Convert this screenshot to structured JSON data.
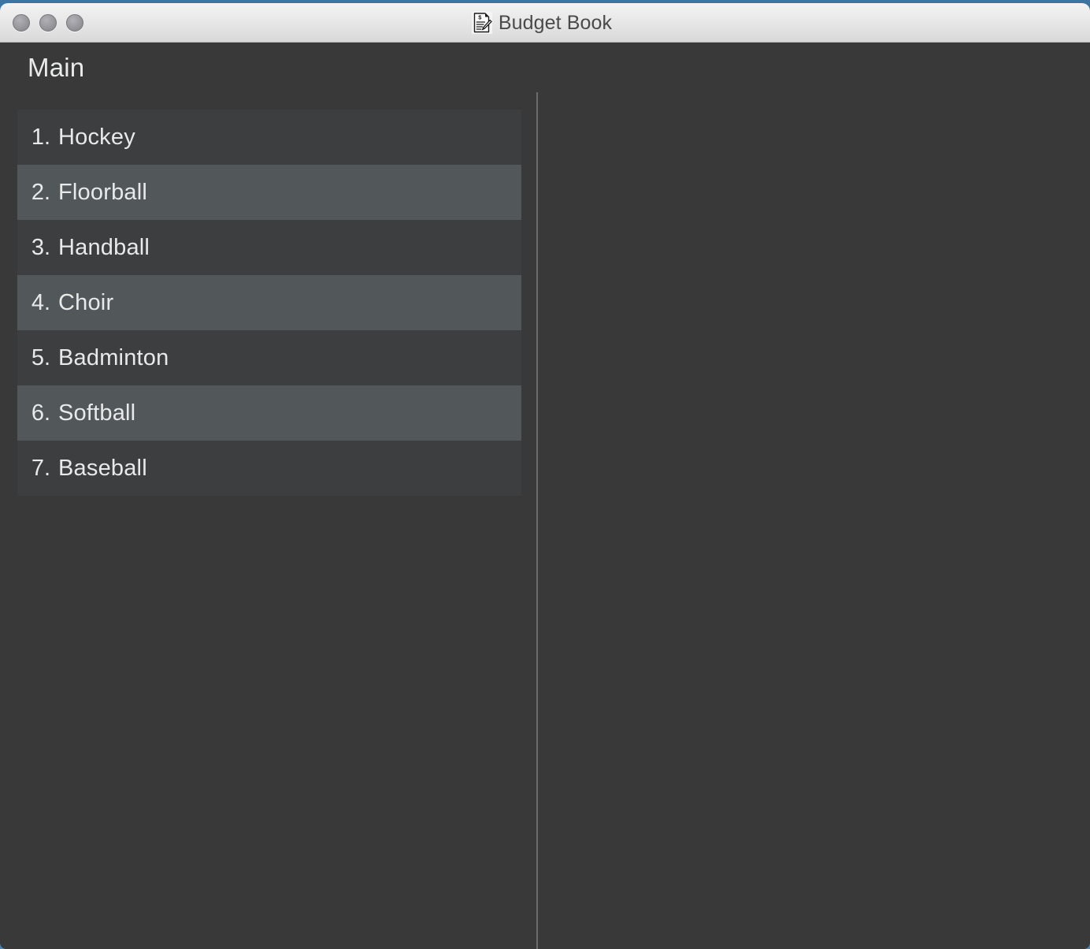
{
  "window": {
    "title": "Budget Book",
    "icon": "budget-document-pencil-icon",
    "traffic_lights": [
      {
        "name": "close-button",
        "color": "#97979c"
      },
      {
        "name": "minimize-button",
        "color": "#97979c"
      },
      {
        "name": "zoom-button",
        "color": "#97979c"
      }
    ],
    "titlebar_gradient_top": "#f2f2f2",
    "titlebar_gradient_bottom": "#d9d9d9",
    "desktop_color": "#4a7ba7"
  },
  "content": {
    "page_title": "Main",
    "background_color": "#393939",
    "row_color": "#3c3e3f",
    "row_alt_color": "#52585a",
    "text_color": "#e8e9e9",
    "divider_color": "#6b6d6d"
  },
  "list": {
    "items": [
      {
        "index": "1.",
        "label": "Hockey"
      },
      {
        "index": "2.",
        "label": "Floorball"
      },
      {
        "index": "3.",
        "label": "Handball"
      },
      {
        "index": "4.",
        "label": "Choir"
      },
      {
        "index": "5.",
        "label": "Badminton"
      },
      {
        "index": "6.",
        "label": "Softball"
      },
      {
        "index": "7.",
        "label": "Baseball"
      }
    ]
  }
}
